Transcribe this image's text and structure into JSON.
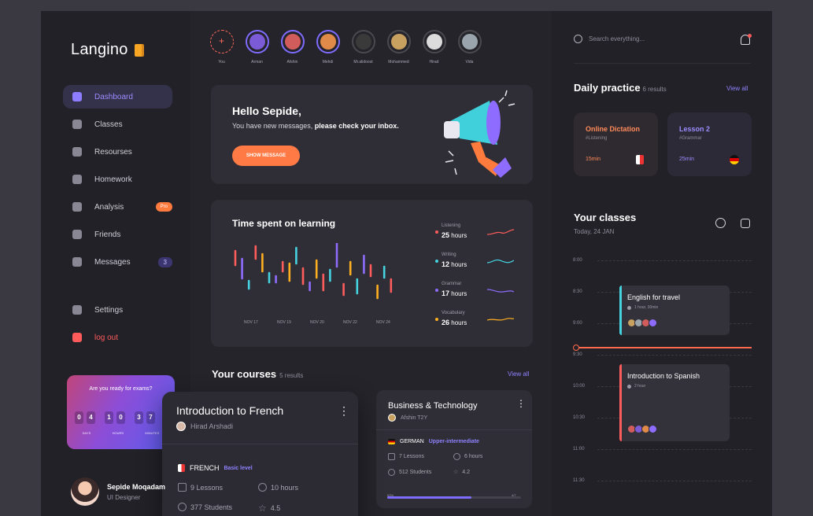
{
  "app": {
    "name": "Langino"
  },
  "sidebar": {
    "items": [
      {
        "label": "Dashboard",
        "icon": "dashboard-icon",
        "active": true
      },
      {
        "label": "Classes",
        "icon": "grid-icon"
      },
      {
        "label": "Resourses",
        "icon": "folder-icon"
      },
      {
        "label": "Homework",
        "icon": "home-icon"
      },
      {
        "label": "Analysis",
        "icon": "chart-icon",
        "badge": "Pro"
      },
      {
        "label": "Friends",
        "icon": "users-icon"
      },
      {
        "label": "Messages",
        "icon": "message-icon",
        "badge": "3"
      }
    ],
    "settings": "Settings",
    "logout": "log out"
  },
  "exam": {
    "title": "Are you ready for exams?",
    "digits": [
      "0",
      "4",
      "1",
      "0",
      "3",
      "7"
    ],
    "units": [
      "DAYS",
      "HOURS",
      "MINUTES"
    ]
  },
  "user": {
    "name": "Sepide Moqadam",
    "role": "UI Designer"
  },
  "stories": [
    {
      "name": "You",
      "add": true
    },
    {
      "name": "Arman",
      "color": "#7b5bd6"
    },
    {
      "name": "Afshin",
      "color": "#d05c5c"
    },
    {
      "name": "Mehdi",
      "color": "#e08a4a"
    },
    {
      "name": "Mr.alidoost",
      "color": "#3a3a3a"
    },
    {
      "name": "Mohammed",
      "color": "#c8a060"
    },
    {
      "name": "Hirad",
      "color": "#dcdcdc"
    },
    {
      "name": "Vida",
      "color": "#9aa4ad"
    }
  ],
  "hello": {
    "title": "Hello Sepide,",
    "sub_plain": "You have new messages, ",
    "sub_bold": "please check your inbox.",
    "button": "SHOW MESSAGE"
  },
  "time_spent": {
    "title": "Time spent on learning",
    "legend": [
      {
        "label": "Listening",
        "value": "25",
        "unit": "hours",
        "color": "#ff5c5c"
      },
      {
        "label": "Writing",
        "value": "12",
        "unit": "hours",
        "color": "#46d3e0"
      },
      {
        "label": "Grammar",
        "value": "17",
        "unit": "hours",
        "color": "#8e6cff"
      },
      {
        "label": "Vocabulary",
        "value": "26",
        "unit": "hours",
        "color": "#ffb020"
      }
    ]
  },
  "chart_data": {
    "type": "bar",
    "x_tick_labels": [
      "NOV 17",
      "NOV 19",
      "NOV 20",
      "NOV 22",
      "NOV 24"
    ]
  },
  "courses": {
    "title": "Your courses",
    "count": "5 results",
    "view_all": "View all",
    "big": {
      "title": "Introduction to French",
      "author": "Hirad Arshadi",
      "language": "FRENCH",
      "level": "Basic level",
      "lessons": "9 Lessons",
      "hours": "10 hours",
      "students": "377 Students",
      "rating": "4.5"
    },
    "small": {
      "title": "Business & Technology",
      "author": "Afshin T2Y",
      "language": "GERMAN",
      "level": "Upper-intermediate",
      "lessons": "7 Lessons",
      "hours": "6 hours",
      "students": "512 Students",
      "rating": "4.2",
      "progress_label": "63%",
      "progress_value": 0.63,
      "progress_total": "4/7"
    }
  },
  "right": {
    "search_placeholder": "Search everything...",
    "daily": {
      "title": "Daily practice",
      "count": "6 results",
      "view_all": "View all",
      "cards": [
        {
          "title": "Online Dictation",
          "tag": "#Listening",
          "time": "15min",
          "color": "#ff8a5a"
        },
        {
          "title": "Lesson 2",
          "tag": "#Grammar",
          "time": "25min",
          "color": "#9b8cff"
        }
      ]
    },
    "classes": {
      "title": "Your classes",
      "date": "Today, 24 JAN",
      "times": [
        "8:00",
        "8:30",
        "9:00",
        "9:30",
        "10:00",
        "10:30",
        "11:00",
        "11:30"
      ],
      "events": [
        {
          "title": "English for travel",
          "duration": "1 hour, 30min",
          "color": "#46d3e0"
        },
        {
          "title": "Introduction to Spanish",
          "duration": "2 hour",
          "color": "#ff5c5c"
        }
      ]
    }
  }
}
